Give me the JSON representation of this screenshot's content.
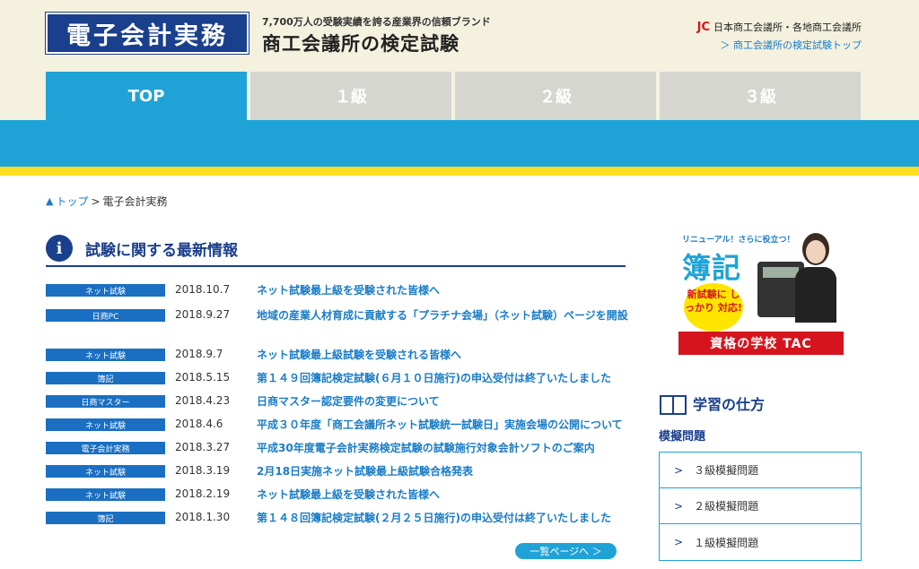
{
  "header": {
    "logo": "電子会計実務",
    "tagline": "7,700万人の受験実績を誇る産業界の信頼ブランド",
    "site_title": "商工会議所の検定試験",
    "org": "日本商工会議所・各地商工会議所",
    "org_mark": "JC",
    "top_link": "＞ 商工会議所の検定試験トップ"
  },
  "nav": [
    {
      "label": "TOP",
      "active": true
    },
    {
      "label": "１級",
      "active": false
    },
    {
      "label": "２級",
      "active": false
    },
    {
      "label": "３級",
      "active": false
    }
  ],
  "breadcrumb": {
    "home": "トップ",
    "sep": ">",
    "current": "電子会計実務"
  },
  "news_section": {
    "title": "試験に関する最新情報",
    "items": [
      {
        "category": "ネット試験",
        "date": "2018.10.7",
        "title": "ネット試験最上級を受験された皆様へ"
      },
      {
        "category": "日商PC",
        "date": "2018.9.27",
        "title": "地域の産業人材育成に貢献する「プラチナ会場」（ネット試験）ページを開設"
      },
      {
        "category": "ネット試験",
        "date": "2018.9.7",
        "title": "ネット試験最上級試験を受験される皆様へ"
      },
      {
        "category": "簿記",
        "date": "2018.5.15",
        "title": "第１４９回簿記検定試験(６月１０日施行)の申込受付は終了いたしました"
      },
      {
        "category": "日商マスター",
        "date": "2018.4.23",
        "title": "日商マスター認定要件の変更について"
      },
      {
        "category": "ネット試験",
        "date": "2018.4.6",
        "title": "平成３０年度「商工会議所ネット試験統一試験日」実施会場の公開について"
      },
      {
        "category": "電子会計実務",
        "date": "2018.3.27",
        "title": "平成30年度電子会計実務検定試験の試験施行対象会計ソフトのご案内"
      },
      {
        "category": "ネット試験",
        "date": "2018.3.19",
        "title": "2月18日実施ネット試験最上級試験合格発表"
      },
      {
        "category": "ネット試験",
        "date": "2018.2.19",
        "title": "ネット試験最上級を受験された皆様へ"
      },
      {
        "category": "簿記",
        "date": "2018.1.30",
        "title": "第１４８回簿記検定試験(２月２５日施行)の申込受付は終了いたしました"
      }
    ],
    "more_label": "一覧ページへ ＞"
  },
  "ad": {
    "top_text": "リニューアル！さらに役立つ！",
    "big_text": "簿記",
    "burst_text": "新試験に しっかり 対応!",
    "bottom_text": "資格の学校 TAC"
  },
  "study": {
    "title": "学習の仕方",
    "subtitle": "模擬問題",
    "items": [
      "３級模擬問題",
      "２級模擬問題",
      "１級模擬問題"
    ],
    "chevron": ">"
  },
  "colors": {
    "navy": "#1a3f8c",
    "sky": "#1fa3d6",
    "yellow": "#ffdd22",
    "cream": "#f4f1df",
    "badge": "#1a6fc2"
  }
}
